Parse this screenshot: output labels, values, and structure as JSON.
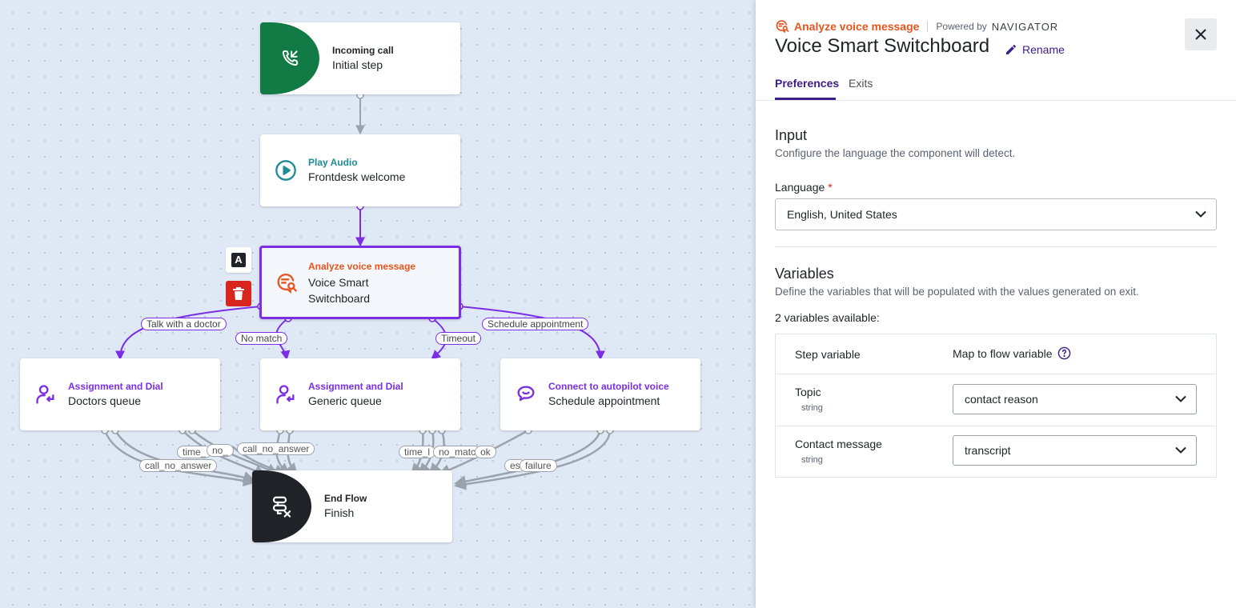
{
  "flow": {
    "nodes": {
      "incoming": {
        "kind": "Incoming call",
        "name": "Initial step"
      },
      "play_audio": {
        "kind": "Play Audio",
        "name": "Frontdesk welcome"
      },
      "analyze": {
        "kind": "Analyze voice message",
        "name": "Voice Smart Switchboard"
      },
      "doctors": {
        "kind": "Assignment and Dial",
        "name": "Doctors queue"
      },
      "generic": {
        "kind": "Assignment and Dial",
        "name": "Generic queue"
      },
      "autopilot": {
        "kind": "Connect to autopilot voice",
        "name": "Schedule appointment"
      },
      "end": {
        "kind": "End Flow",
        "name": "Finish"
      }
    },
    "edge_labels": {
      "talk_with_doctor": "Talk with a doctor",
      "no_match": "No match",
      "timeout": "Timeout",
      "schedule_appointment": "Schedule appointment",
      "call_no_answer_1": "call_no_answer",
      "time_1": "time_",
      "no_1": "no_",
      "call_no_answer_2": "call_no_answer",
      "time_2": "time_l",
      "no_match_2": "no_matc",
      "ok": "ok",
      "es": "es",
      "failure": "failure"
    },
    "floating_tools": {
      "text_tool_glyph": "A"
    },
    "colors": {
      "purple": "#7b2ee6",
      "orange": "#e8541c",
      "teal": "#1f8c96",
      "green": "#127a45",
      "dark": "#1f2328",
      "red": "#d8261f"
    }
  },
  "panel": {
    "component_label": "Analyze voice message",
    "powered_by": "Powered by",
    "brand": "NAVIGATOR",
    "title": "Voice Smart Switchboard",
    "rename": "Rename",
    "tabs": [
      "Preferences",
      "Exits"
    ],
    "active_tab": "Preferences",
    "input": {
      "title": "Input",
      "description": "Configure the language the component will detect.",
      "language_label": "Language",
      "required_mark": "*",
      "language_value": "English, United States"
    },
    "variables": {
      "title": "Variables",
      "description": "Define the variables that will be populated with the values generated on exit.",
      "available": "2 variables available:",
      "col_step": "Step variable",
      "col_map": "Map to flow variable",
      "rows": [
        {
          "name": "Topic",
          "type": "string",
          "value": "contact reason"
        },
        {
          "name": "Contact message",
          "type": "string",
          "value": "transcript"
        }
      ]
    }
  }
}
